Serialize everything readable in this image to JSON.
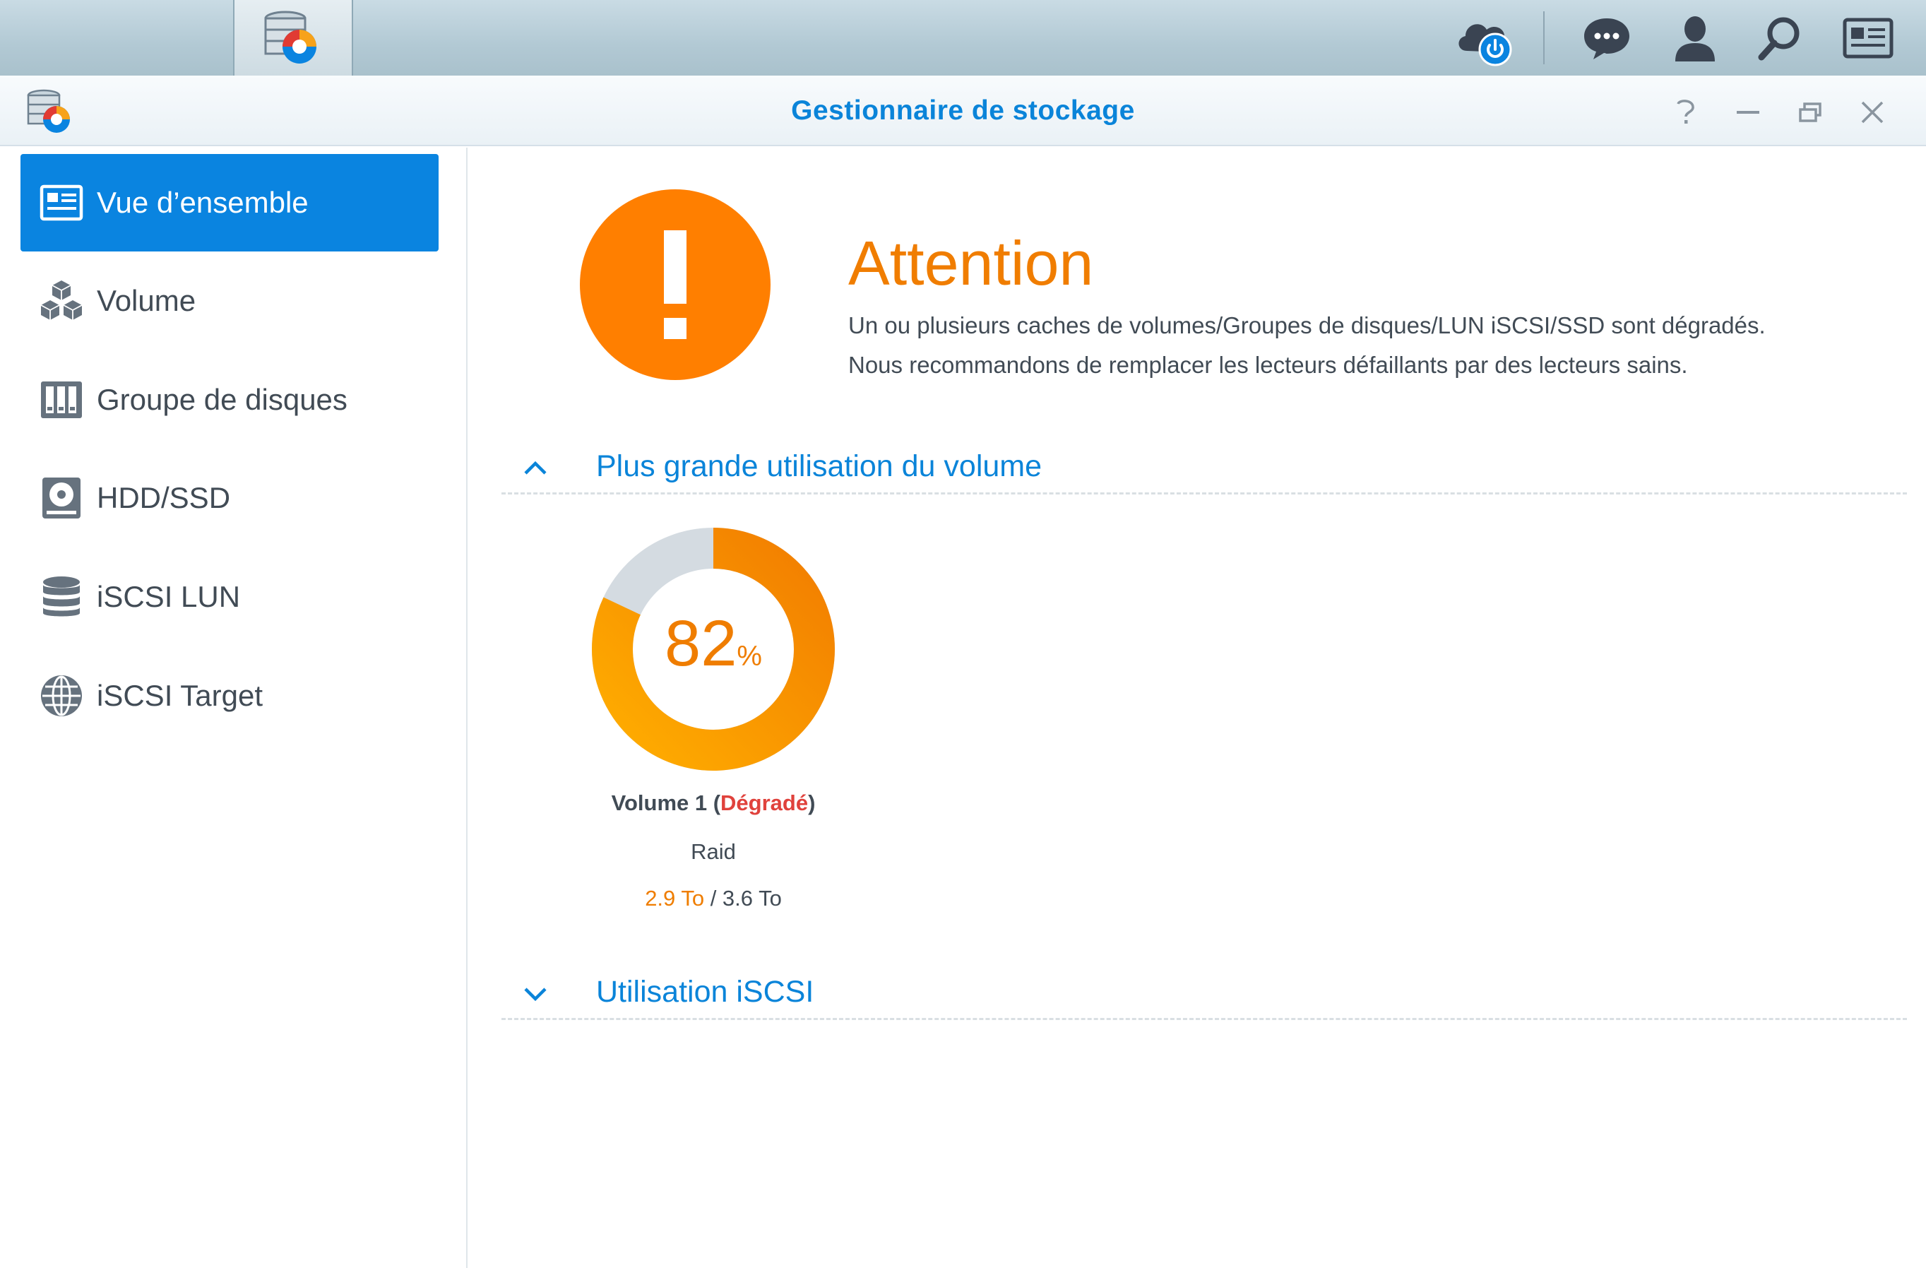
{
  "window": {
    "title": "Gestionnaire de stockage"
  },
  "taskbar": {
    "main_menu_icon": "grid-menu-icon",
    "app_icon": "storage-manager-icon",
    "right_icons": [
      "cloud-power-icon",
      "chat-icon",
      "user-icon",
      "search-icon",
      "widgets-icon"
    ]
  },
  "sidebar": {
    "items": [
      {
        "label": "Vue d’ensemble",
        "icon": "overview-icon",
        "active": true
      },
      {
        "label": "Volume",
        "icon": "cubes-icon",
        "active": false
      },
      {
        "label": "Groupe de disques",
        "icon": "disk-group-icon",
        "active": false
      },
      {
        "label": "HDD/SSD",
        "icon": "hdd-icon",
        "active": false
      },
      {
        "label": "iSCSI LUN",
        "icon": "database-icon",
        "active": false
      },
      {
        "label": "iSCSI Target",
        "icon": "globe-icon",
        "active": false
      }
    ]
  },
  "status": {
    "title": "Attention",
    "line1": "Un ou plusieurs caches de volumes/Groupes de disques/LUN iSCSI/SSD sont dégradés.",
    "line2": "Nous recommandons de remplacer les lecteurs défaillants par des lecteurs sains."
  },
  "sections": {
    "volume_usage": {
      "label": "Plus grande utilisation du volume",
      "expanded": true
    },
    "iscsi_usage": {
      "label": "Utilisation iSCSI",
      "expanded": false
    }
  },
  "volume": {
    "name": "Volume 1",
    "open_paren": " (",
    "state": "Dégradé",
    "close_paren": ")",
    "type": "Raid",
    "usage_percent": 82,
    "usage_value": "82",
    "usage_symbol": "%",
    "used": "2.9 To",
    "separator": " / ",
    "total": "3.6 To"
  },
  "colors": {
    "accent": "#0a84d9",
    "warning": "#f07d00",
    "degraded": "#e0423c",
    "donut_free": "#d4dbe1"
  }
}
